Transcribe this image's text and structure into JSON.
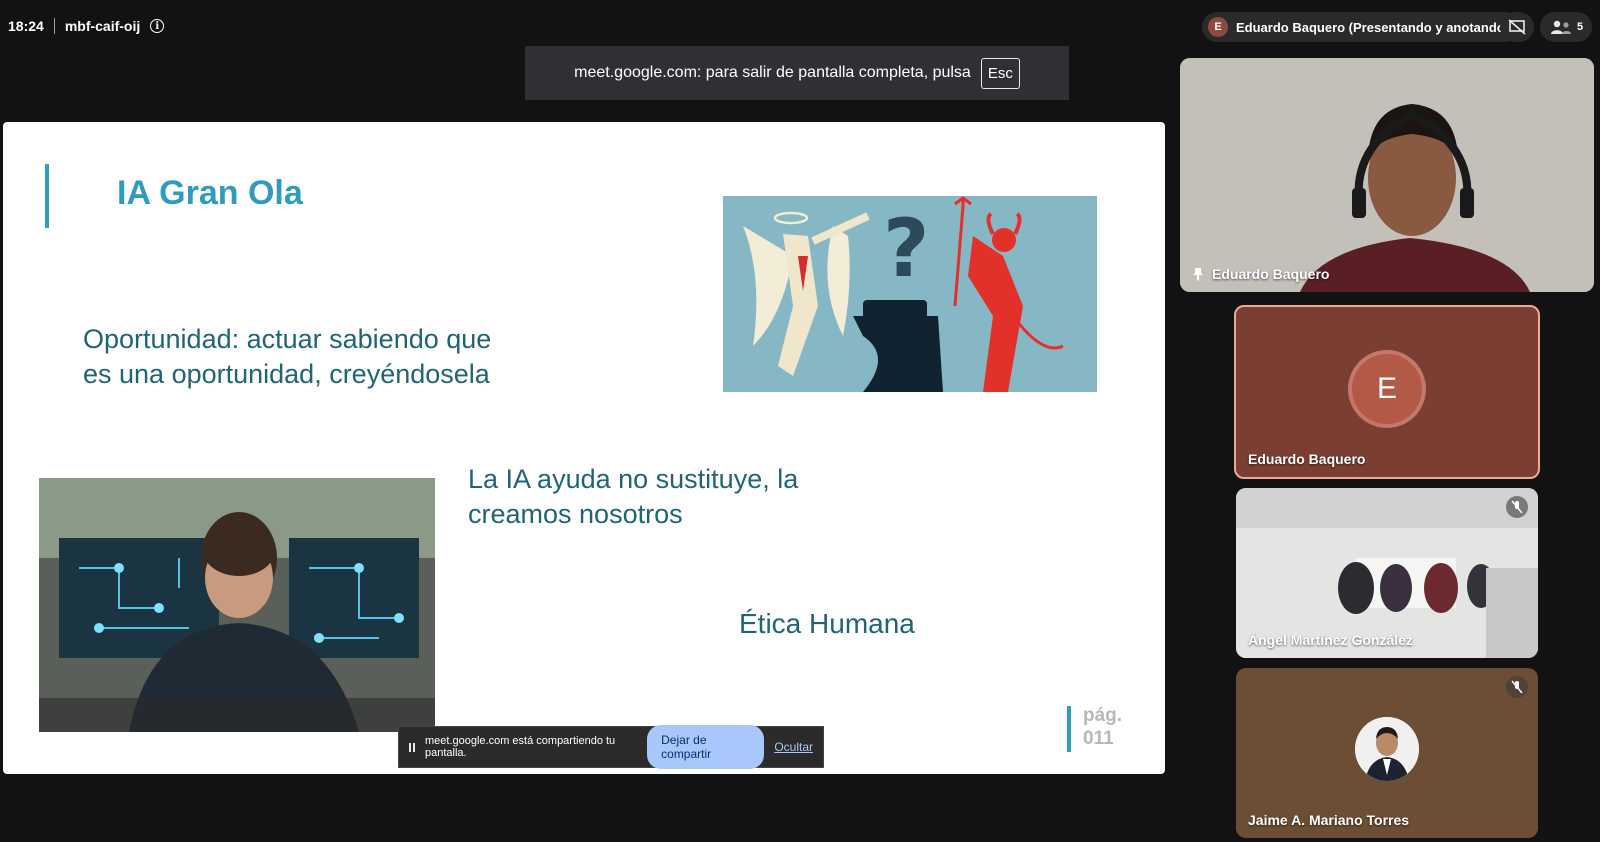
{
  "topbar": {
    "time": "18:24",
    "meeting_code": "mbf-caif-oij",
    "presenter_initial": "E",
    "presenter_label": "Eduardo Baquero (Presentando y anotando)",
    "participant_count": "5"
  },
  "fullscreen_banner": {
    "text": "meet.google.com: para salir de pantalla completa, pulsa",
    "key": "Esc"
  },
  "slide": {
    "title": "IA Gran Ola",
    "text1": "Oportunidad: actuar sabiendo que es una oportunidad, creyéndosela",
    "text2": "La IA ayuda no sustituye, la creamos nosotros",
    "text3": "Ética Humana",
    "page_label": "pág.",
    "page_number": "011"
  },
  "share_bar": {
    "text": "meet.google.com está compartiendo tu pantalla.",
    "stop_label": "Dejar de compartir",
    "hide_label": "Ocultar"
  },
  "participants": {
    "main": {
      "name": "Eduardo Baquero"
    },
    "e_tile": {
      "name": "Eduardo Baquero",
      "initial": "E"
    },
    "angel": {
      "name": "Ángel Martínez González"
    },
    "jaime": {
      "name": "Jaime A. Mariano Torres"
    }
  },
  "colors": {
    "accent": "#2f9bbf",
    "slide_text": "#1f6576",
    "button": "#a8c7fa"
  }
}
